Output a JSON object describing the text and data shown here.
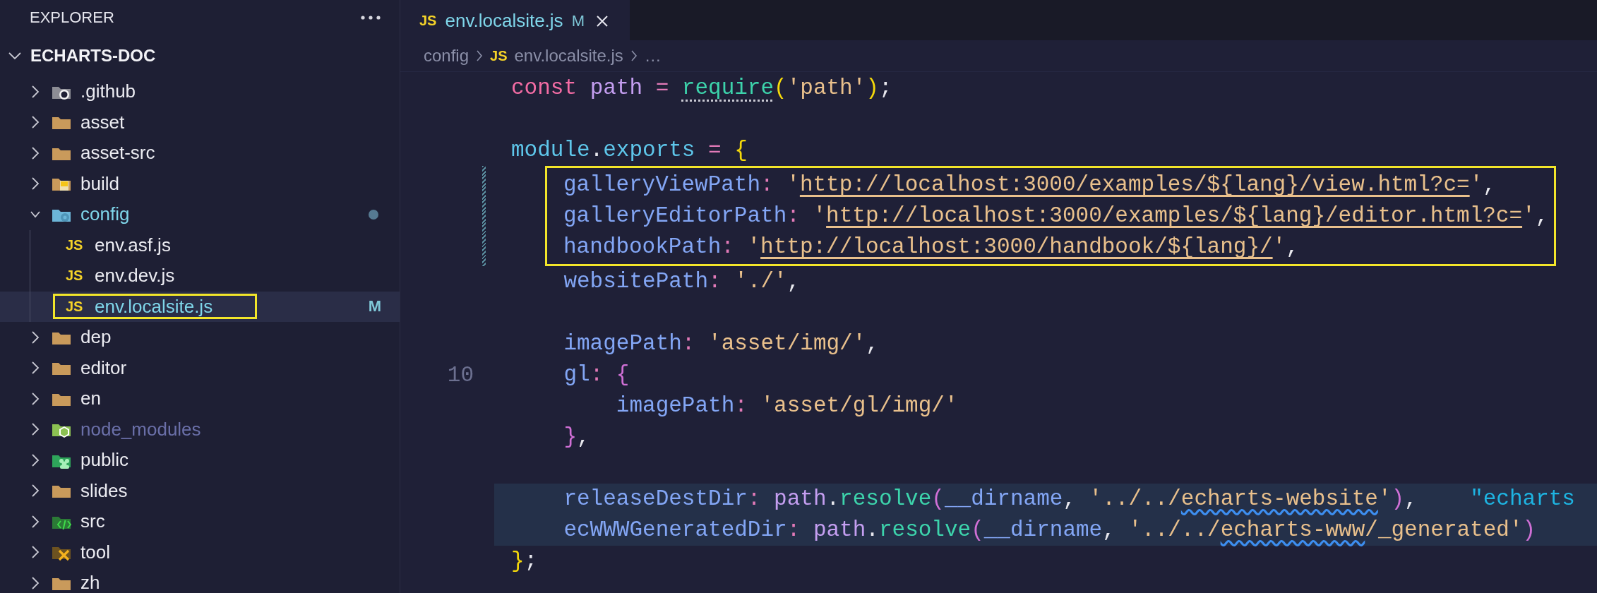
{
  "sidebar": {
    "title": "EXPLORER",
    "root": {
      "label": "ECHARTS-DOC",
      "expanded": true
    },
    "items": [
      {
        "label": ".github",
        "kind": "repo",
        "expanded": false,
        "selected": false,
        "modified": false,
        "ignored": false,
        "annotated": false
      },
      {
        "label": "asset",
        "kind": "folder",
        "expanded": false,
        "selected": false,
        "modified": false,
        "ignored": false,
        "annotated": false
      },
      {
        "label": "asset-src",
        "kind": "folder",
        "expanded": false,
        "selected": false,
        "modified": false,
        "ignored": false,
        "annotated": false
      },
      {
        "label": "build",
        "kind": "build",
        "expanded": false,
        "selected": false,
        "modified": false,
        "ignored": false,
        "annotated": false
      },
      {
        "label": "config",
        "kind": "config",
        "expanded": true,
        "selected": false,
        "modified": true,
        "ignored": false,
        "annotated": false,
        "children": [
          {
            "label": "env.asf.js",
            "kind": "file",
            "icon_label": "JS",
            "selected": false,
            "modified": false,
            "ignored": false,
            "annotated": false
          },
          {
            "label": "env.dev.js",
            "kind": "file",
            "icon_label": "JS",
            "selected": false,
            "modified": false,
            "ignored": false,
            "annotated": false
          },
          {
            "label": "env.localsite.js",
            "kind": "file",
            "icon_label": "JS",
            "status": "M",
            "selected": true,
            "modified": true,
            "ignored": false,
            "annotated": true
          }
        ]
      },
      {
        "label": "dep",
        "kind": "folder",
        "expanded": false,
        "selected": false,
        "modified": false,
        "ignored": false,
        "annotated": false
      },
      {
        "label": "editor",
        "kind": "folder",
        "expanded": false,
        "selected": false,
        "modified": false,
        "ignored": false,
        "annotated": false
      },
      {
        "label": "en",
        "kind": "folder",
        "expanded": false,
        "selected": false,
        "modified": false,
        "ignored": false,
        "annotated": false
      },
      {
        "label": "node_modules",
        "kind": "package",
        "expanded": false,
        "selected": false,
        "modified": false,
        "ignored": true,
        "annotated": false
      },
      {
        "label": "public",
        "kind": "public",
        "expanded": false,
        "selected": false,
        "modified": false,
        "ignored": false,
        "annotated": false
      },
      {
        "label": "slides",
        "kind": "folder",
        "expanded": false,
        "selected": false,
        "modified": false,
        "ignored": false,
        "annotated": false
      },
      {
        "label": "src",
        "kind": "source",
        "expanded": false,
        "selected": false,
        "modified": false,
        "ignored": false,
        "annotated": false
      },
      {
        "label": "tool",
        "kind": "tools",
        "expanded": false,
        "selected": false,
        "modified": false,
        "ignored": false,
        "annotated": false
      },
      {
        "label": "zh",
        "kind": "folder",
        "expanded": false,
        "selected": false,
        "modified": false,
        "ignored": false,
        "annotated": false
      }
    ]
  },
  "tabs": [
    {
      "icon_label": "JS",
      "label": "env.localsite.js",
      "status": "M",
      "modified": true,
      "selected": true
    }
  ],
  "breadcrumb": [
    {
      "label": "config"
    },
    {
      "icon_label": "JS",
      "label": "env.localsite.js"
    },
    {
      "label": "…"
    }
  ],
  "code": {
    "blocks": [
      {
        "boxed": false,
        "modified": false,
        "lines": [
          {
            "kind": "code",
            "highlighted": false,
            "tokens": [
              {
                "text": "const ",
                "kind": "kw"
              },
              {
                "text": "path",
                "kind": "var"
              },
              {
                "text": " = ",
                "kind": "op"
              },
              {
                "text": "require",
                "kind": "fnhint"
              },
              {
                "text": "(",
                "kind": "paren-y"
              },
              {
                "text": "'path'",
                "kind": "str"
              },
              {
                "text": ")",
                "kind": "paren-y"
              },
              {
                "text": ";",
                "kind": "punct"
              }
            ]
          },
          {
            "kind": "blank"
          },
          {
            "kind": "code",
            "highlighted": false,
            "tokens": [
              {
                "text": "module",
                "kind": "obj"
              },
              {
                "text": ".",
                "kind": "punct"
              },
              {
                "text": "exports",
                "kind": "obj"
              },
              {
                "text": " = ",
                "kind": "op"
              },
              {
                "text": "{",
                "kind": "paren-y"
              }
            ]
          }
        ]
      },
      {
        "boxed": true,
        "modified": true,
        "lines": [
          {
            "kind": "code",
            "highlighted": false,
            "tokens": [
              {
                "text": "galleryViewPath",
                "kind": "prop"
              },
              {
                "text": ": ",
                "kind": "op"
              },
              {
                "text": "'",
                "kind": "str"
              },
              {
                "text": "http://localhost:3000/examples/${lang}/view.html?c=",
                "kind": "link"
              },
              {
                "text": "'",
                "kind": "str"
              },
              {
                "text": ",",
                "kind": "punct"
              }
            ]
          },
          {
            "kind": "code",
            "highlighted": false,
            "tokens": [
              {
                "text": "galleryEditorPath",
                "kind": "prop"
              },
              {
                "text": ": ",
                "kind": "op"
              },
              {
                "text": "'",
                "kind": "str"
              },
              {
                "text": "http://localhost:3000/examples/${lang}/editor.html?c=",
                "kind": "link"
              },
              {
                "text": "'",
                "kind": "str"
              },
              {
                "text": ",",
                "kind": "punct"
              }
            ]
          },
          {
            "kind": "code",
            "highlighted": false,
            "tokens": [
              {
                "text": "handbookPath",
                "kind": "prop"
              },
              {
                "text": ": ",
                "kind": "op"
              },
              {
                "text": "'",
                "kind": "str"
              },
              {
                "text": "http://localhost:3000/handbook/${lang}/",
                "kind": "link"
              },
              {
                "text": "'",
                "kind": "str"
              },
              {
                "text": ",",
                "kind": "punct"
              }
            ]
          }
        ]
      },
      {
        "boxed": false,
        "modified": false,
        "lines": [
          {
            "kind": "code",
            "highlighted": false,
            "tokens": [
              {
                "text": "    websitePath",
                "kind": "prop"
              },
              {
                "text": ": ",
                "kind": "op"
              },
              {
                "text": "'./'",
                "kind": "str"
              },
              {
                "text": ",",
                "kind": "punct"
              }
            ]
          },
          {
            "kind": "blank"
          },
          {
            "kind": "code",
            "highlighted": false,
            "tokens": [
              {
                "text": "    imagePath",
                "kind": "prop"
              },
              {
                "text": ": ",
                "kind": "op"
              },
              {
                "text": "'asset/img/'",
                "kind": "str"
              },
              {
                "text": ",",
                "kind": "punct"
              }
            ]
          },
          {
            "kind": "code",
            "highlighted": false,
            "line_number": "10",
            "tokens": [
              {
                "text": "    gl",
                "kind": "prop"
              },
              {
                "text": ": ",
                "kind": "op"
              },
              {
                "text": "{",
                "kind": "paren-p"
              }
            ]
          },
          {
            "kind": "code",
            "highlighted": false,
            "tokens": [
              {
                "text": "        imagePath",
                "kind": "prop"
              },
              {
                "text": ": ",
                "kind": "op"
              },
              {
                "text": "'asset/gl/img/'",
                "kind": "str"
              }
            ]
          },
          {
            "kind": "code",
            "highlighted": false,
            "tokens": [
              {
                "text": "    }",
                "kind": "paren-p"
              },
              {
                "text": ",",
                "kind": "punct"
              }
            ]
          },
          {
            "kind": "blank"
          },
          {
            "kind": "code",
            "highlighted": true,
            "tokens": [
              {
                "text": "    releaseDestDir",
                "kind": "prop"
              },
              {
                "text": ": ",
                "kind": "op"
              },
              {
                "text": "path",
                "kind": "var"
              },
              {
                "text": ".",
                "kind": "punct"
              },
              {
                "text": "resolve",
                "kind": "fn"
              },
              {
                "text": "(",
                "kind": "paren-p"
              },
              {
                "text": "__dirname",
                "kind": "prop"
              },
              {
                "text": ", ",
                "kind": "punct"
              },
              {
                "text": "'../../",
                "kind": "str"
              },
              {
                "text": "echarts-website",
                "kind": "spell"
              },
              {
                "text": "'",
                "kind": "str"
              },
              {
                "text": ")",
                "kind": "paren-p"
              },
              {
                "text": ",    ",
                "kind": "punct"
              },
              {
                "text": "\"echarts",
                "kind": "str2"
              }
            ]
          },
          {
            "kind": "code",
            "highlighted": true,
            "tokens": [
              {
                "text": "    ecWWWGeneratedDir",
                "kind": "prop"
              },
              {
                "text": ": ",
                "kind": "op"
              },
              {
                "text": "path",
                "kind": "var"
              },
              {
                "text": ".",
                "kind": "punct"
              },
              {
                "text": "resolve",
                "kind": "fn"
              },
              {
                "text": "(",
                "kind": "paren-p"
              },
              {
                "text": "__dirname",
                "kind": "prop"
              },
              {
                "text": ", ",
                "kind": "punct"
              },
              {
                "text": "'../../",
                "kind": "str"
              },
              {
                "text": "echarts-www",
                "kind": "spell"
              },
              {
                "text": "/_generated'",
                "kind": "str"
              },
              {
                "text": ")",
                "kind": "paren-p"
              }
            ]
          },
          {
            "kind": "code",
            "highlighted": false,
            "tokens": [
              {
                "text": "}",
                "kind": "paren-y"
              },
              {
                "text": ";",
                "kind": "punct"
              }
            ]
          }
        ]
      }
    ]
  }
}
